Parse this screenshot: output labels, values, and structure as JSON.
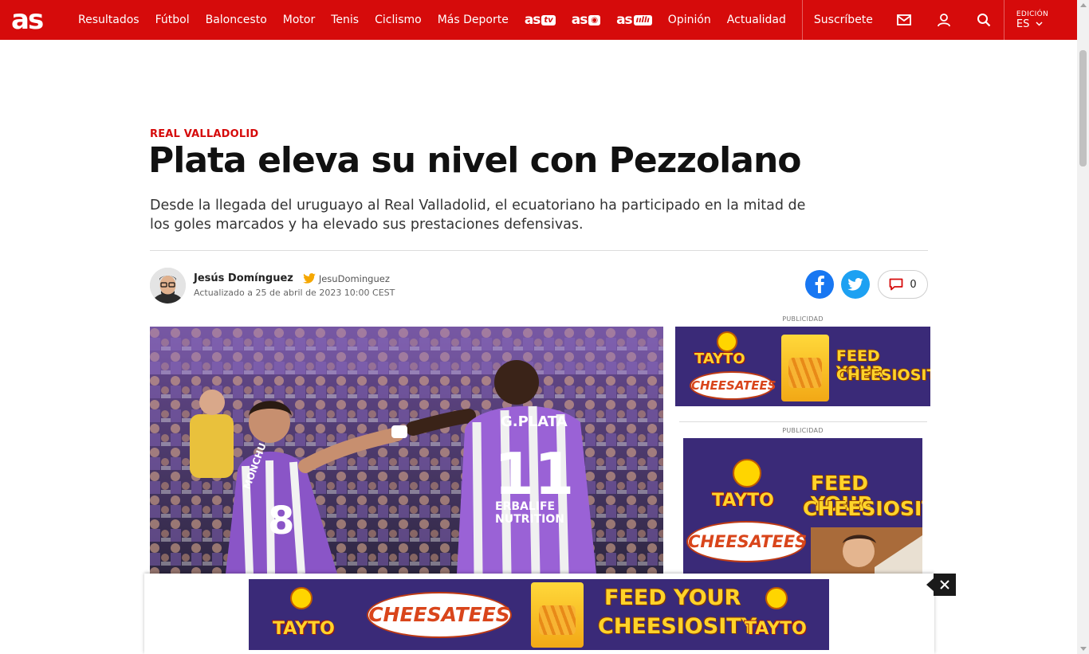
{
  "header": {
    "logo": "as",
    "nav": [
      "Resultados",
      "Fútbol",
      "Baloncesto",
      "Motor",
      "Tenis",
      "Ciclismo",
      "Más Deporte"
    ],
    "brands": [
      {
        "main": "as",
        "tag": "tv"
      },
      {
        "main": "as",
        "tag": "◉"
      },
      {
        "main": "as",
        "tag": "ııllı"
      }
    ],
    "nav2": [
      "Opinión",
      "Actualidad"
    ],
    "subscribe": "Suscríbete",
    "edition_label": "EDICIÓN",
    "edition_value": "ES"
  },
  "article": {
    "kicker": "REAL VALLADOLID",
    "headline": "Plata eleva su nivel con Pezzolano",
    "subhead": "Desde la llegada del uruguayo al Real Valladolid, el ecuatoriano ha participado en la mitad de los goles marcados y ha elevado sus prestaciones defensivas.",
    "author": "Jesús Domínguez",
    "twitter": "JesuDominguez",
    "updated": "Actualizado a 25 de abril de 2023 10:00 CEST",
    "comments": "0"
  },
  "photo": {
    "jersey_back_name": "G.PLATA",
    "jersey_back_number": "11",
    "jersey_front_number": "8",
    "sponsor_line1": "ERBALIFE",
    "sponsor_line2": "NUTRITION",
    "left_player_name": "MONCHU"
  },
  "ads": {
    "label": "PUBLICIDAD",
    "brand": "TAYTO",
    "product": "CHEESATEES",
    "slogan_line1": "FEED YOUR",
    "slogan_line2": "CHEESIOSITY"
  },
  "colors": {
    "brand_red": "#d60b0b",
    "facebook": "#1877f2",
    "twitter": "#1da1f2",
    "ad_purple": "#3a2a78"
  }
}
